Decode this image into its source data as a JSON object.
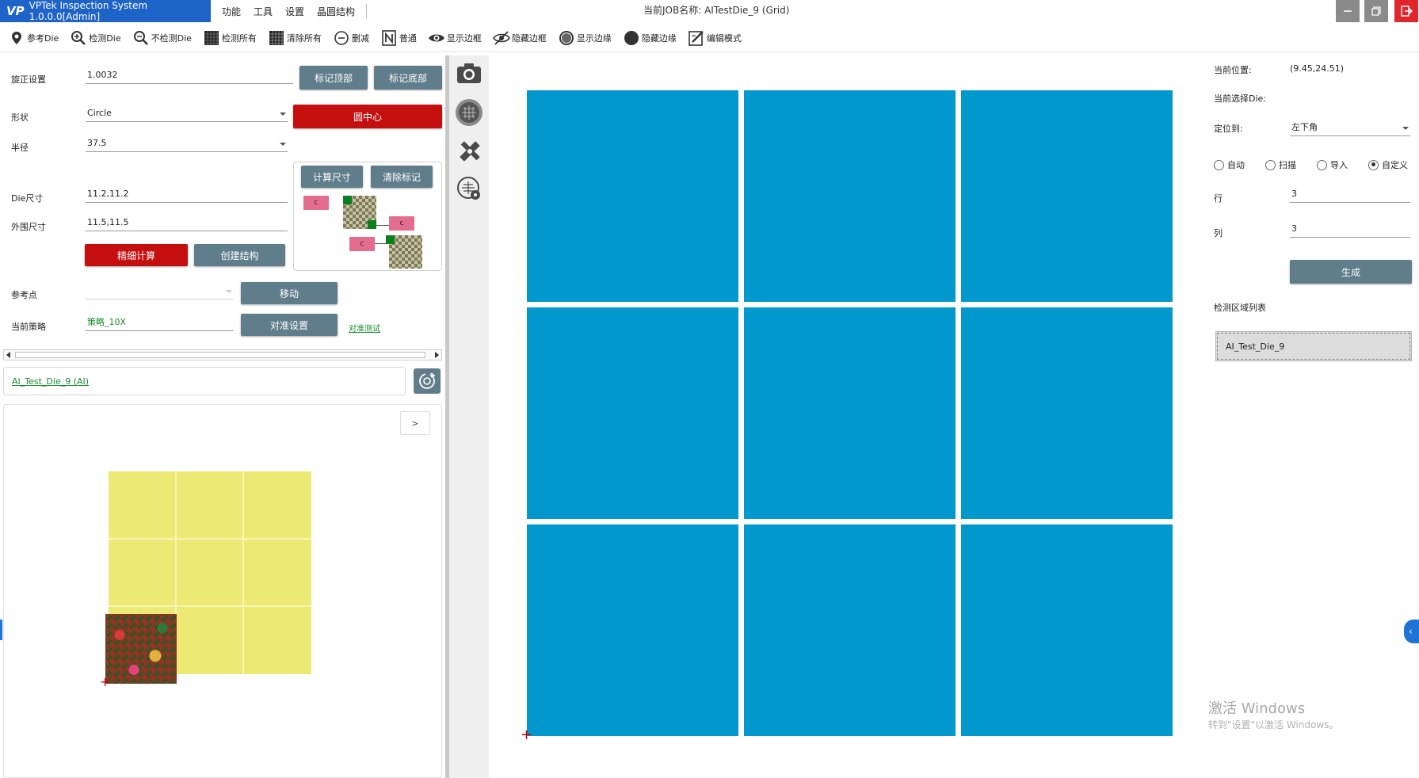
{
  "titlebar": {
    "app_title": "VPTek Inspection System 1.0.0.0[Admin]",
    "logo": "VP",
    "menus": [
      "功能",
      "工具",
      "设置",
      "晶圆结构"
    ],
    "job_title": "当前JOB名称: AITestDie_9 (Grid)"
  },
  "toolbar": {
    "items": [
      {
        "label": "参考Die",
        "icon": "pin-icon"
      },
      {
        "label": "检测Die",
        "icon": "zoom-in-icon"
      },
      {
        "label": "不检测Die",
        "icon": "zoom-out-icon"
      },
      {
        "label": "检测所有",
        "icon": "grid-all-icon"
      },
      {
        "label": "清除所有",
        "icon": "grid-clear-icon"
      },
      {
        "label": "删减",
        "icon": "minus-circle-icon"
      },
      {
        "label": "普通",
        "icon": "n-box-icon"
      },
      {
        "label": "显示边框",
        "icon": "eye-icon"
      },
      {
        "label": "隐藏边框",
        "icon": "eye-off-icon"
      },
      {
        "label": "显示边缘",
        "icon": "circle-ring-icon"
      },
      {
        "label": "隐藏边缘",
        "icon": "filled-circle-icon"
      },
      {
        "label": "编辑模式",
        "icon": "edit-icon"
      }
    ]
  },
  "left": {
    "rotation_label": "旋正设置",
    "rotation_value": "1.0032",
    "mark_top": "标记顶部",
    "mark_bottom": "标记底部",
    "shape_label": "形状",
    "shape_value": "Circle",
    "center_button": "圆中心",
    "radius_label": "半径",
    "radius_value": "37.5",
    "calc_size": "计算尺寸",
    "clear_marks": "清除标记",
    "tag_c": "c",
    "die_size_label": "Die尺寸",
    "die_size_value": "11.2,11.2",
    "outer_size_label": "外围尺寸",
    "outer_size_value": "11.5,11.5",
    "fine_calc": "精细计算",
    "create_structure": "创建结构",
    "ref_point_label": "参考点",
    "ref_point_value": "",
    "move_button": "移动",
    "strategy_label": "当前策略",
    "strategy_value": "策略_10X",
    "align_settings": "对准设置",
    "align_test": "对准测试",
    "recipe_name": "AI_Test_Die_9 (AI)",
    "expand": ">"
  },
  "right": {
    "position_label": "当前位置:",
    "position_value": "(9.45,24.51)",
    "selected_die_label": "当前选择Die:",
    "locate_label": "定位到:",
    "locate_value": "左下角",
    "radios": [
      {
        "label": "自动",
        "checked": false
      },
      {
        "label": "扫描",
        "checked": false
      },
      {
        "label": "导入",
        "checked": false
      },
      {
        "label": "自定义",
        "checked": true
      }
    ],
    "rows_label": "行",
    "rows_value": "3",
    "cols_label": "列",
    "cols_value": "3",
    "generate": "生成",
    "region_list_label": "检测区域列表",
    "regions": [
      "AI_Test_Die_9"
    ]
  },
  "grid": {
    "rows": 3,
    "cols": 3,
    "die_color": "#0198cd"
  },
  "watermark": {
    "line1": "激活 Windows",
    "line2": "转到\"设置\"以激活 Windows。"
  },
  "colors": {
    "accent": "#1e63c8",
    "button": "#607d8b",
    "danger": "#c50f0f",
    "die": "#0198cd",
    "mini_map": "#ecea74"
  }
}
